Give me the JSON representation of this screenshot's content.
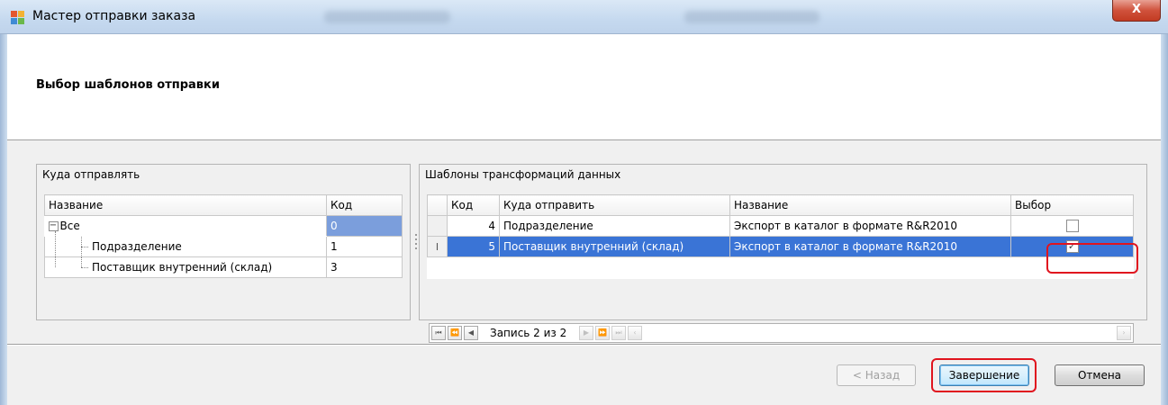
{
  "window": {
    "title": "Мастер отправки заказа",
    "close_label": "X"
  },
  "header": {
    "page_title": "Выбор шаблонов отправки"
  },
  "destinations": {
    "caption": "Куда отправлять",
    "columns": [
      "Название",
      "Код"
    ],
    "rows": [
      {
        "name": "Все",
        "code": "0",
        "expander": "−"
      },
      {
        "name": "Подразделение",
        "code": "1"
      },
      {
        "name": "Поставщик внутренний (склад)",
        "code": "3"
      }
    ]
  },
  "templates": {
    "caption": "Шаблоны  трансформаций данных",
    "columns": [
      "Код",
      "Куда отправить",
      "Название",
      "Выбор"
    ],
    "rows": [
      {
        "code": "4",
        "dest": "Подразделение",
        "name": "Экспорт в каталог в формате  R&R2010",
        "checked": false
      },
      {
        "code": "5",
        "dest": "Поставщик внутренний (склад)",
        "name": "Экспорт в каталог в формате R&R2010",
        "checked": true
      }
    ],
    "navigator": {
      "record_label": "Запись 2 из 2"
    }
  },
  "buttons": {
    "back": "< Назад",
    "finish": "Завершение",
    "cancel": "Отмена"
  },
  "colors": {
    "selection": "#3a74d6",
    "highlight": "#e0141e"
  }
}
